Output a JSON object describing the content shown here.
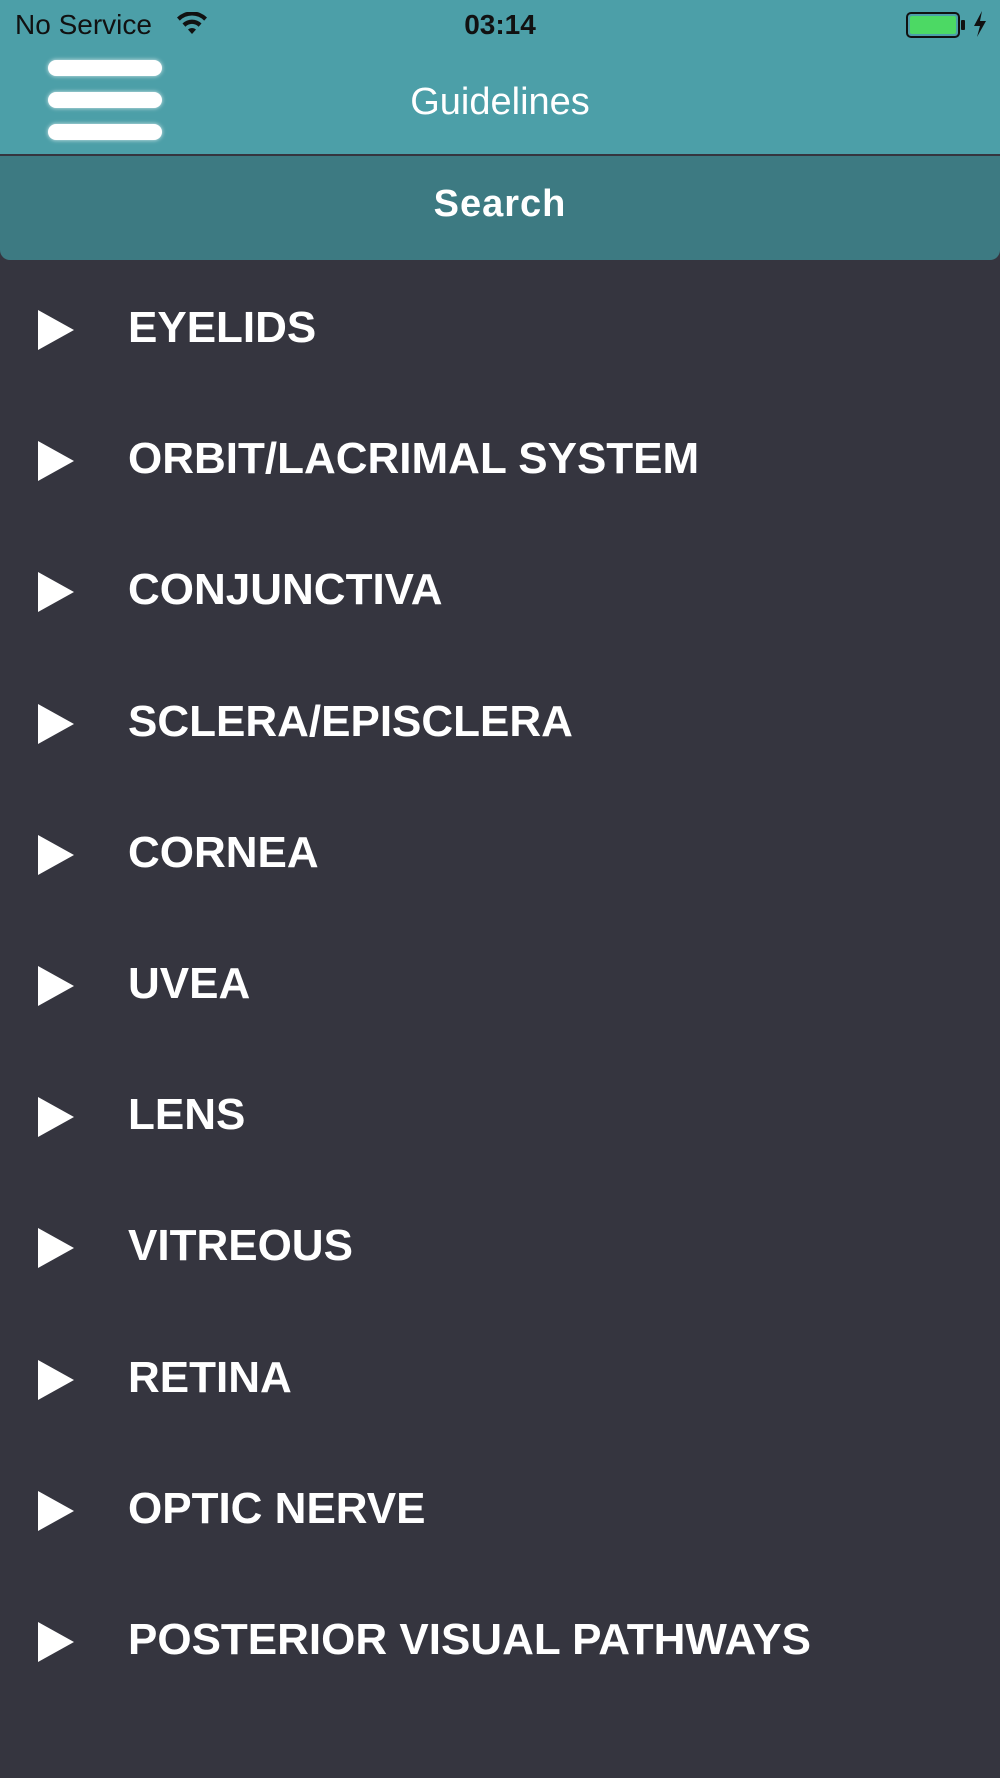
{
  "status_bar": {
    "carrier": "No Service",
    "time": "03:14",
    "wifi_icon": "wifi-icon",
    "battery_icon": "battery-icon",
    "battery_color": "#4cd964"
  },
  "header": {
    "menu_icon": "hamburger-menu-icon",
    "title": "Guidelines",
    "background_color": "#4c9fa8"
  },
  "search": {
    "label": "Search",
    "background_color": "#3d7a82"
  },
  "list": {
    "items": [
      {
        "label": "EYELIDS"
      },
      {
        "label": "ORBIT/LACRIMAL SYSTEM"
      },
      {
        "label": "CONJUNCTIVA"
      },
      {
        "label": "SCLERA/EPISCLERA"
      },
      {
        "label": "CORNEA"
      },
      {
        "label": "UVEA"
      },
      {
        "label": "LENS"
      },
      {
        "label": "VITREOUS"
      },
      {
        "label": "RETINA"
      },
      {
        "label": "OPTIC NERVE"
      },
      {
        "label": "POSTERIOR VISUAL PATHWAYS"
      }
    ],
    "item_icon": "play-triangle-icon",
    "background_color": "#35353f"
  }
}
